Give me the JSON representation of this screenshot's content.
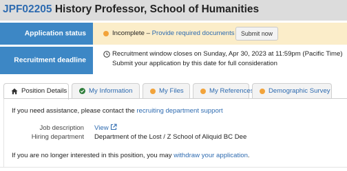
{
  "header": {
    "job_id": "JPF02205",
    "job_title": "History Professor, School of Humanities"
  },
  "status": {
    "label": "Application status",
    "state": "Incomplete",
    "separator": " – ",
    "link_text": "Provide required documents",
    "submit_label": "Submit now"
  },
  "deadline": {
    "label": "Recruitment deadline",
    "line1": "Recruitment window closes on Sunday, Apr 30, 2023 at 11:59pm (Pacific Time)",
    "line2": "Submit your application by this date for full consideration"
  },
  "tabs": [
    {
      "label": "Position Details",
      "icon": "home-icon",
      "active": true
    },
    {
      "label": "My Information",
      "icon": "check-circle-icon",
      "active": false
    },
    {
      "label": "My Files",
      "icon": "orange-dot-icon",
      "active": false
    },
    {
      "label": "My References",
      "icon": "orange-dot-icon",
      "active": false
    },
    {
      "label": "Demographic Survey",
      "icon": "orange-dot-icon",
      "active": false
    }
  ],
  "panel": {
    "help_prefix": "If you need assistance, please contact the ",
    "help_link": "recruiting department support",
    "job_description_label": "Job description",
    "job_description_link": "View",
    "hiring_department_label": "Hiring department",
    "hiring_department_value": "Department of the Lost / Z School of Aliquid BC Dee",
    "withdraw_prefix": "If you are no longer interested in this position, you may ",
    "withdraw_link": "withdraw your application",
    "withdraw_suffix": "."
  },
  "colors": {
    "label_bg": "#3d87c5",
    "status_bg": "#fbedc9",
    "link": "#2e6bb0",
    "incomplete_dot": "#f2a33a",
    "complete_check": "#2d7d3a"
  }
}
